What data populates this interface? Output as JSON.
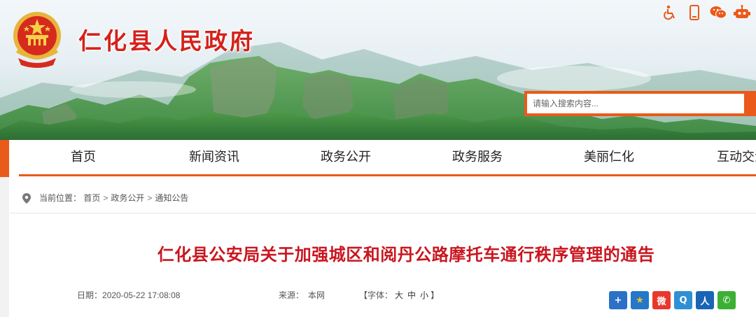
{
  "site": {
    "title": "仁化县人民政府"
  },
  "top_tools": [
    {
      "icon": "accessibility-icon",
      "name": "accessibility"
    },
    {
      "icon": "mobile-phone-icon",
      "name": "mobile"
    },
    {
      "icon": "wechat-icon",
      "name": "wechat"
    },
    {
      "icon": "robot-icon",
      "name": "robot"
    }
  ],
  "search": {
    "placeholder": "请输入搜索内容..."
  },
  "nav": {
    "items": [
      "首页",
      "新闻资讯",
      "政务公开",
      "政务服务",
      "美丽仁化",
      "互动交流"
    ]
  },
  "breadcrumb": {
    "label": "当前位置：",
    "items": [
      "首页",
      "政务公开",
      "通知公告"
    ],
    "separator": ">"
  },
  "article": {
    "title": "仁化县公安局关于加强城区和阅丹公路摩托车通行秩序管理的通告",
    "date_label": "日期：",
    "date": "2020-05-22 17:08:08",
    "source_label": "来源：",
    "source": "本网",
    "font_label_open": "【字体：",
    "font_sizes": [
      "大",
      "中",
      "小"
    ],
    "font_label_close": "】"
  },
  "share_buttons": [
    {
      "icon": "plus-share-icon",
      "glyph": "+",
      "color": "#2a71c7"
    },
    {
      "icon": "qzone-star-icon",
      "glyph": "★",
      "color": "#2477c9"
    },
    {
      "icon": "weibo-icon",
      "glyph": "微",
      "color": "#e8382b"
    },
    {
      "icon": "tencent-weibo-icon",
      "glyph": "Q",
      "color": "#2f8fd5"
    },
    {
      "icon": "renren-icon",
      "glyph": "人",
      "color": "#1a64b5"
    },
    {
      "icon": "wechat-share-icon",
      "glyph": "✆",
      "color": "#3cb034"
    }
  ],
  "colors": {
    "brand_red": "#d5211b",
    "accent_orange": "#ea5a1a",
    "title_red": "#c9161f"
  }
}
